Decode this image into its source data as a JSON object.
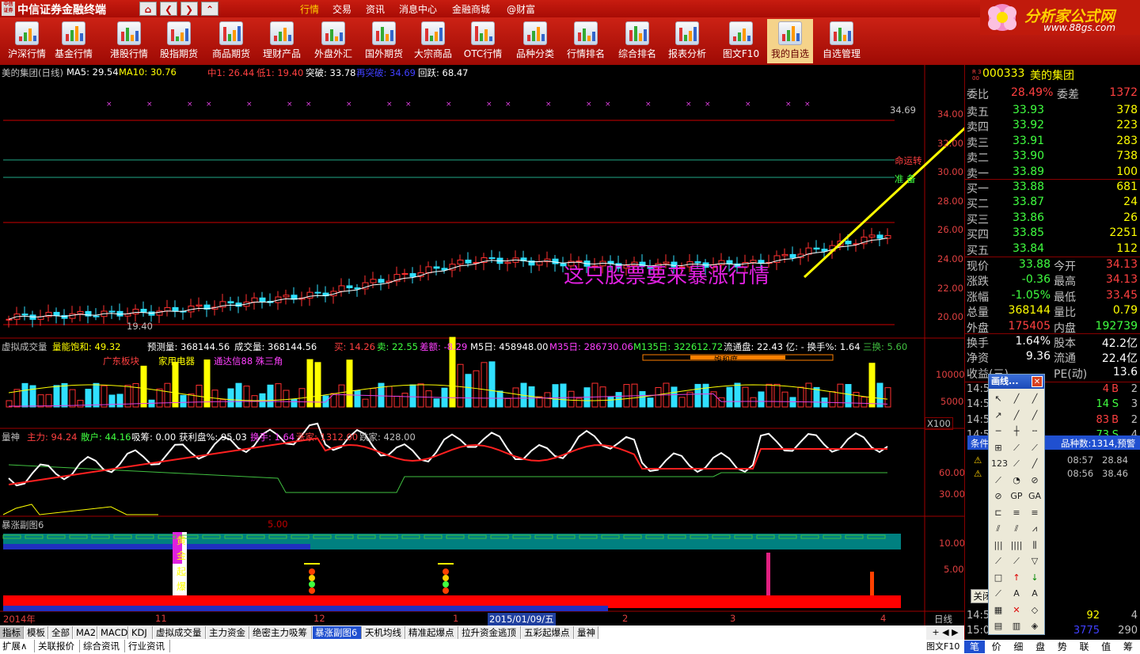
{
  "app": {
    "badge": "中信证券",
    "title": "中信证券金融终端"
  },
  "nav": [
    "⌂",
    "❮",
    "❯",
    "⌃"
  ],
  "top_menu": [
    "行情",
    "交易",
    "资讯",
    "消息中心",
    "金融商城",
    "@财富"
  ],
  "brand": {
    "name": "分析家公式网",
    "url": "www.88gs.com"
  },
  "toolbar": [
    "沪深行情",
    "基金行情",
    "港股行情",
    "股指期货",
    "商品期货",
    "理财产品",
    "外盘外汇",
    "国外期货",
    "大宗商品",
    "OTC行情",
    "品种分类",
    "行情排名",
    "综合排名",
    "报表分析",
    "图文F10",
    "我的自选",
    "自选管理"
  ],
  "toolbar_active": 15,
  "main_header": {
    "name": "美的集团(日线)",
    "ma5": "MA5: 29.54",
    "ma10": "MA10: 30.76",
    "zhong1": "中1: 26.44",
    "di1": "低1: 19.40",
    "tupo": "突破: 33.78",
    "zaitupo": "再突破: 34.69",
    "huiyue": "回跃: 68.47"
  },
  "price_axis": [
    "34.00",
    "32.00",
    "30.00",
    "28.00",
    "26.00",
    "24.00",
    "22.00",
    "20.00"
  ],
  "line_labels": {
    "mingyun": "命运转",
    "zhun": "准 备",
    "high_mark": "34.69",
    "low_mark": "19.40"
  },
  "annotation": "这只股票要来暴涨行情",
  "vol_header": {
    "title": "虚拟成交量",
    "nlbh": "量能饱和: 49.32",
    "yucel": "预测量: 368144.56",
    "chengjiao": "成交量: 368144.56",
    "mai": "买: 14.26",
    "maic": "卖: 22.55",
    "chae": "差额: -8.29",
    "m5": "M5日: 458948.00",
    "m35": "M35日: 286730.06",
    "m135": "M135日: 322612.72",
    "liutong": "流通盘: 22.43 亿: - 换手%: 1.64",
    "sanhuan": "三换: 5.60"
  },
  "vol_sub": {
    "a": "广东板块",
    "b": "家用电器",
    "c": "通达信88 殊三角",
    "d": "饱和度"
  },
  "vol_axis": [
    "10000",
    "5000",
    "X100"
  ],
  "lsj_header": {
    "title": "量神",
    "zhuli": "主力: 94.24",
    "sanhu": "散户: 44.16",
    "xichou": "吸筹: 0.00",
    "huoli": "获利盘%: 95.03",
    "huanshou": "换手: 1.64",
    "zhangjia": "涨家: 1312.00",
    "diejia": "跌家: 428.00"
  },
  "lsj_axis": [
    "60.00",
    "30.00"
  ],
  "bz_header": {
    "title": "暴涨副图6",
    "val": "5.00"
  },
  "bz_axis": [
    "10.00",
    "5.00"
  ],
  "bz_chars": [
    "黄",
    "金",
    "起",
    "爆"
  ],
  "date_axis": {
    "y": "2014年",
    "m11": "11",
    "m12": "12",
    "m1": "1",
    "cursor": "2015/01/09/五",
    "m2": "2",
    "m3": "3",
    "m4": "4",
    "rlabel": "日线"
  },
  "tabs": [
    "指标",
    "模板",
    "全部",
    "MA2",
    "MACD",
    "KDJ",
    "虚拟成交量",
    "主力资金",
    "绝密主力吸筹",
    "暴涨副图6",
    "天机均线",
    "精准起爆点",
    "拉升资金逃顶",
    "五彩起爆点",
    "量神"
  ],
  "tabs_active": 9,
  "tabs2": [
    "扩展∧",
    "关联报价",
    "综合资讯",
    "行业资讯"
  ],
  "stock": {
    "market": "R 300",
    "code": "000333",
    "name": "美的集团"
  },
  "weibi": {
    "label": "委比",
    "value": "28.49%",
    "label2": "委差",
    "value2": "1372"
  },
  "sell": [
    {
      "l": "卖五",
      "p": "33.93",
      "v": "378"
    },
    {
      "l": "卖四",
      "p": "33.92",
      "v": "223"
    },
    {
      "l": "卖三",
      "p": "33.91",
      "v": "283"
    },
    {
      "l": "卖二",
      "p": "33.90",
      "v": "738"
    },
    {
      "l": "卖一",
      "p": "33.89",
      "v": "100"
    }
  ],
  "buy": [
    {
      "l": "买一",
      "p": "33.88",
      "v": "681"
    },
    {
      "l": "买二",
      "p": "33.87",
      "v": "24"
    },
    {
      "l": "买三",
      "p": "33.86",
      "v": "26"
    },
    {
      "l": "买四",
      "p": "33.85",
      "v": "2251"
    },
    {
      "l": "买五",
      "p": "33.84",
      "v": "112"
    }
  ],
  "stats": [
    {
      "l": "现价",
      "v": "33.88",
      "l2": "今开",
      "v2": "34.13"
    },
    {
      "l": "涨跌",
      "v": "-0.36",
      "l2": "最高",
      "v2": "34.13"
    },
    {
      "l": "涨幅",
      "v": "-1.05%",
      "l2": "最低",
      "v2": "33.45"
    },
    {
      "l": "总量",
      "v": "368144",
      "l2": "量比",
      "v2": "0.79"
    },
    {
      "l": "外盘",
      "v": "175405",
      "l2": "内盘",
      "v2": "192739"
    }
  ],
  "stats2": [
    {
      "l": "换手",
      "v": "1.64%",
      "l2": "股本",
      "v2": "42.2亿"
    },
    {
      "l": "净资",
      "v": "9.36",
      "l2": "流通",
      "v2": "22.4亿"
    },
    {
      "l": "收益(三)",
      "v": "",
      "l2": "PE(动)",
      "v2": "13.6"
    }
  ],
  "ticks": [
    {
      "t": "14:5",
      "v": "4",
      "f": "B",
      "n": "2"
    },
    {
      "t": "14:5",
      "v": "14",
      "f": "S",
      "n": "3"
    },
    {
      "t": "14:5",
      "v": "83",
      "f": "B",
      "n": "2"
    },
    {
      "t": "14:5",
      "v": "73",
      "f": "S",
      "n": "4"
    }
  ],
  "cond": {
    "title": "条件",
    "count": "品种数:1314,预警",
    "rows": [
      {
        "t": "08:57",
        "v": "28.84"
      },
      {
        "t": "08:56",
        "v": "38.46"
      }
    ],
    "close": "关闭"
  },
  "ticks2": [
    {
      "t": "14:5",
      "v": "92",
      "n": "4"
    },
    {
      "t": "15:0",
      "v": "3775",
      "n": "290"
    }
  ],
  "draw_panel": {
    "title": "画线..."
  },
  "bottom_right": [
    "图文F10"
  ],
  "bottom_tabs": [
    "笔",
    "价",
    "细",
    "盘",
    "势",
    "联",
    "值",
    "筹"
  ]
}
